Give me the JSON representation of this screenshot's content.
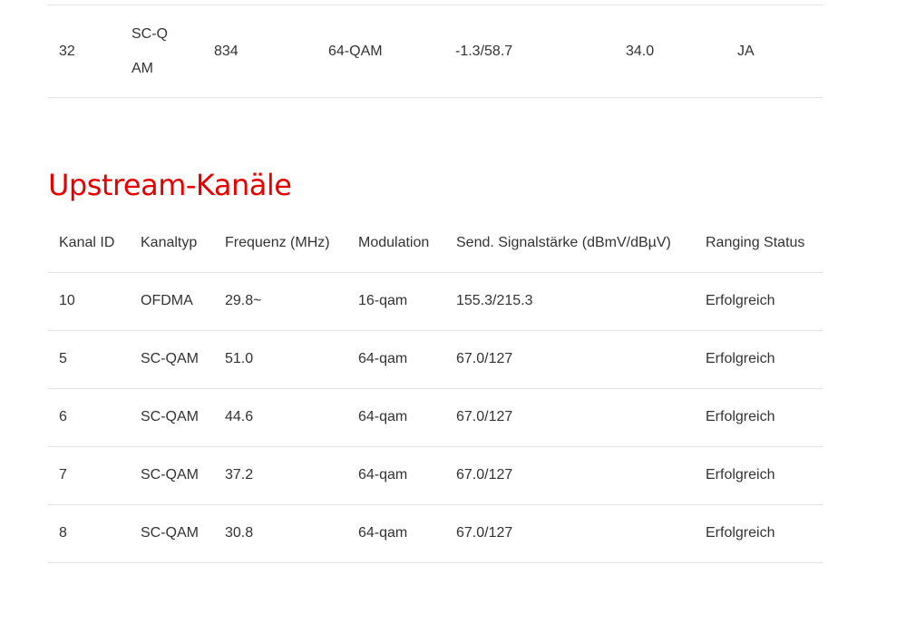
{
  "downstream": {
    "last_row": {
      "channel_id": "32",
      "channel_type": "SC-QAM",
      "frequency": "834",
      "modulation": "64-QAM",
      "power": "-1.3/58.7",
      "snr": "34.0",
      "locked": "JA"
    }
  },
  "upstream": {
    "title": "Upstream-Kanäle",
    "headers": {
      "channel_id": "Kanal ID",
      "channel_type": "Kanaltyp",
      "frequency": "Frequenz (MHz)",
      "modulation": "Modulation",
      "power": "Send. Signalstärke (dBmV/dBµV)",
      "ranging": "Ranging Status"
    },
    "rows": [
      {
        "channel_id": "10",
        "channel_type": "OFDMA",
        "frequency": "29.8~",
        "modulation": "16-qam",
        "power": "155.3/215.3",
        "ranging": "Erfolgreich"
      },
      {
        "channel_id": "5",
        "channel_type": "SC-QAM",
        "frequency": "51.0",
        "modulation": "64-qam",
        "power": "67.0/127",
        "ranging": "Erfolgreich"
      },
      {
        "channel_id": "6",
        "channel_type": "SC-QAM",
        "frequency": "44.6",
        "modulation": "64-qam",
        "power": "67.0/127",
        "ranging": "Erfolgreich"
      },
      {
        "channel_id": "7",
        "channel_type": "SC-QAM",
        "frequency": "37.2",
        "modulation": "64-qam",
        "power": "67.0/127",
        "ranging": "Erfolgreich"
      },
      {
        "channel_id": "8",
        "channel_type": "SC-QAM",
        "frequency": "30.8",
        "modulation": "64-qam",
        "power": "67.0/127",
        "ranging": "Erfolgreich"
      }
    ]
  },
  "colors": {
    "accent": "#e60000",
    "text": "#333333",
    "divider": "#e3e3e3"
  }
}
